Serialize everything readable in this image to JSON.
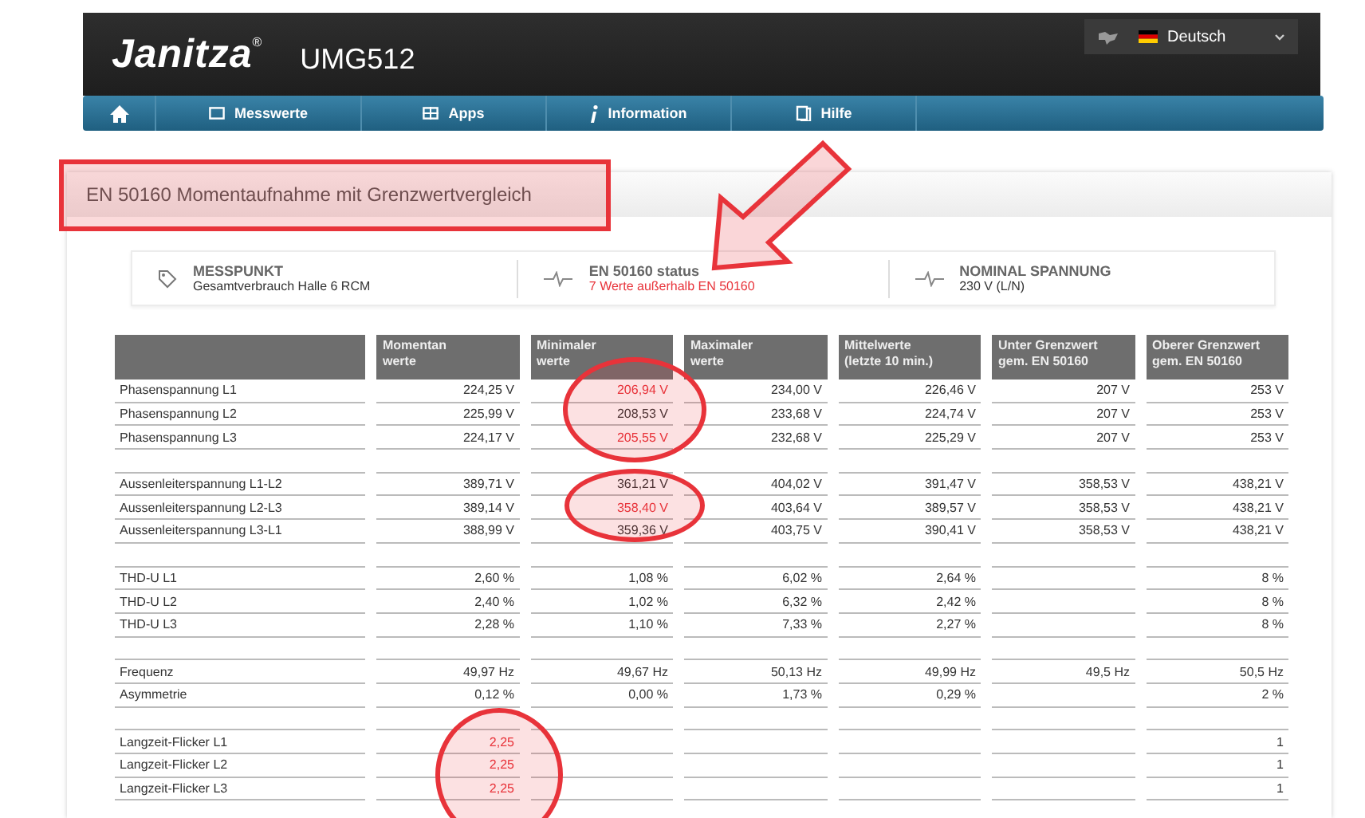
{
  "header": {
    "logo": "Janitza",
    "logo_mark": "®",
    "device": "UMG512",
    "language": "Deutsch"
  },
  "nav": [
    {
      "kind": "home"
    },
    {
      "kind": "monitor",
      "label": "Messwerte"
    },
    {
      "kind": "apps",
      "label": "Apps"
    },
    {
      "kind": "info",
      "label": "Information"
    },
    {
      "kind": "book",
      "label": "Hilfe"
    }
  ],
  "page_title": "EN 50160 Momentaufnahme mit Grenzwertvergleich",
  "summary": [
    {
      "kind": "tag",
      "label": "MESSPUNKT",
      "value": "Gesamtverbrauch Halle 6 RCM",
      "alert": false
    },
    {
      "kind": "pulse",
      "label": "EN 50160 status",
      "value": "7 Werte außerhalb EN 50160",
      "alert": true
    },
    {
      "kind": "pulse",
      "label": "NOMINAL SPANNUNG",
      "value": "230 V (L/N)",
      "alert": false
    }
  ],
  "table": {
    "columns": [
      [
        "Momentan",
        "werte"
      ],
      [
        "Minimaler",
        "werte"
      ],
      [
        "Maximaler",
        "werte"
      ],
      [
        "Mittelwerte",
        "(letzte 10 min.)"
      ],
      [
        "Unter Grenzwert",
        "gem. EN 50160"
      ],
      [
        "Oberer Grenzwert",
        "gem. EN 50160"
      ]
    ],
    "groups": [
      {
        "rows": [
          {
            "label": "Phasenspannung L1",
            "cells": [
              {
                "text": "224,25 V",
                "alert": false
              },
              {
                "text": "206,94 V",
                "alert": true
              },
              {
                "text": "234,00 V",
                "alert": false
              },
              {
                "text": "226,46 V",
                "alert": false
              },
              {
                "text": "207 V",
                "alert": false
              },
              {
                "text": "253 V",
                "alert": false
              }
            ]
          },
          {
            "label": "Phasenspannung L2",
            "cells": [
              {
                "text": "225,99 V",
                "alert": false
              },
              {
                "text": "208,53 V",
                "alert": false
              },
              {
                "text": "233,68 V",
                "alert": false
              },
              {
                "text": "224,74 V",
                "alert": false
              },
              {
                "text": "207 V",
                "alert": false
              },
              {
                "text": "253 V",
                "alert": false
              }
            ]
          },
          {
            "label": "Phasenspannung L3",
            "cells": [
              {
                "text": "224,17 V",
                "alert": false
              },
              {
                "text": "205,55 V",
                "alert": true
              },
              {
                "text": "232,68 V",
                "alert": false
              },
              {
                "text": "225,29 V",
                "alert": false
              },
              {
                "text": "207 V",
                "alert": false
              },
              {
                "text": "253 V",
                "alert": false
              }
            ]
          }
        ]
      },
      {
        "rows": [
          {
            "label": "Aussenleiterspannung L1-L2",
            "cells": [
              {
                "text": "389,71 V",
                "alert": false
              },
              {
                "text": "361,21 V",
                "alert": false
              },
              {
                "text": "404,02 V",
                "alert": false
              },
              {
                "text": "391,47 V",
                "alert": false
              },
              {
                "text": "358,53 V",
                "alert": false
              },
              {
                "text": "438,21 V",
                "alert": false
              }
            ]
          },
          {
            "label": "Aussenleiterspannung L2-L3",
            "cells": [
              {
                "text": "389,14 V",
                "alert": false
              },
              {
                "text": "358,40 V",
                "alert": true
              },
              {
                "text": "403,64 V",
                "alert": false
              },
              {
                "text": "389,57 V",
                "alert": false
              },
              {
                "text": "358,53 V",
                "alert": false
              },
              {
                "text": "438,21 V",
                "alert": false
              }
            ]
          },
          {
            "label": "Aussenleiterspannung L3-L1",
            "cells": [
              {
                "text": "388,99 V",
                "alert": false
              },
              {
                "text": "359,36 V",
                "alert": false
              },
              {
                "text": "403,75 V",
                "alert": false
              },
              {
                "text": "390,41 V",
                "alert": false
              },
              {
                "text": "358,53 V",
                "alert": false
              },
              {
                "text": "438,21 V",
                "alert": false
              }
            ]
          }
        ]
      },
      {
        "rows": [
          {
            "label": "THD-U L1",
            "cells": [
              {
                "text": "2,60 %",
                "alert": false
              },
              {
                "text": "1,08 %",
                "alert": false
              },
              {
                "text": "6,02 %",
                "alert": false
              },
              {
                "text": "2,64 %",
                "alert": false
              },
              null,
              {
                "text": "8 %",
                "alert": false
              }
            ]
          },
          {
            "label": "THD-U L2",
            "cells": [
              {
                "text": "2,40 %",
                "alert": false
              },
              {
                "text": "1,02 %",
                "alert": false
              },
              {
                "text": "6,32 %",
                "alert": false
              },
              {
                "text": "2,42 %",
                "alert": false
              },
              null,
              {
                "text": "8 %",
                "alert": false
              }
            ]
          },
          {
            "label": "THD-U L3",
            "cells": [
              {
                "text": "2,28 %",
                "alert": false
              },
              {
                "text": "1,10 %",
                "alert": false
              },
              {
                "text": "7,33 %",
                "alert": false
              },
              {
                "text": "2,27 %",
                "alert": false
              },
              null,
              {
                "text": "8 %",
                "alert": false
              }
            ]
          }
        ]
      },
      {
        "rows": [
          {
            "label": "Frequenz",
            "cells": [
              {
                "text": "49,97 Hz",
                "alert": false
              },
              {
                "text": "49,67 Hz",
                "alert": false
              },
              {
                "text": "50,13 Hz",
                "alert": false
              },
              {
                "text": "49,99 Hz",
                "alert": false
              },
              {
                "text": "49,5 Hz",
                "alert": false
              },
              {
                "text": "50,5 Hz",
                "alert": false
              }
            ]
          },
          {
            "label": "Asymmetrie",
            "cells": [
              {
                "text": "0,12 %",
                "alert": false
              },
              {
                "text": "0,00 %",
                "alert": false
              },
              {
                "text": "1,73 %",
                "alert": false
              },
              {
                "text": "0,29 %",
                "alert": false
              },
              null,
              {
                "text": "2 %",
                "alert": false
              }
            ]
          }
        ]
      },
      {
        "rows": [
          {
            "label": "Langzeit-Flicker L1",
            "cells": [
              {
                "text": "2,25",
                "alert": true
              },
              null,
              null,
              null,
              null,
              {
                "text": "1",
                "alert": false
              }
            ]
          },
          {
            "label": "Langzeit-Flicker L2",
            "cells": [
              {
                "text": "2,25",
                "alert": true
              },
              null,
              null,
              null,
              null,
              {
                "text": "1",
                "alert": false
              }
            ]
          },
          {
            "label": "Langzeit-Flicker L3",
            "cells": [
              {
                "text": "2,25",
                "alert": true
              },
              null,
              null,
              null,
              null,
              {
                "text": "1",
                "alert": false
              }
            ]
          }
        ]
      }
    ]
  }
}
